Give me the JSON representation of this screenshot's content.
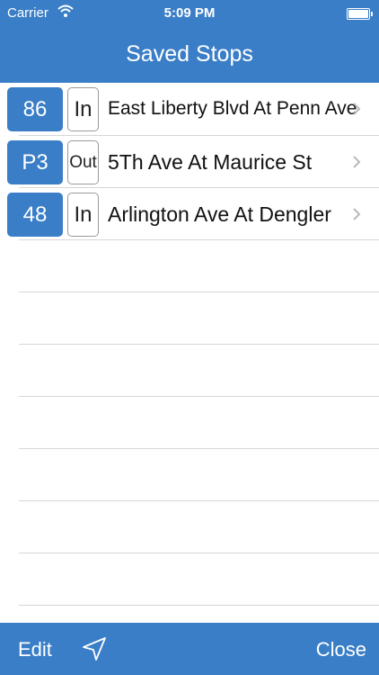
{
  "status_bar": {
    "carrier": "Carrier",
    "time": "5:09 PM",
    "wifi_icon": "wifi-icon",
    "battery_icon": "battery-icon"
  },
  "nav": {
    "title": "Saved Stops"
  },
  "stops": [
    {
      "route": "86",
      "direction": "In",
      "name": "East Liberty Blvd At Penn Ave"
    },
    {
      "route": "P3",
      "direction": "Out",
      "name": "5Th Ave At Maurice St"
    },
    {
      "route": "48",
      "direction": "In",
      "name": "Arlington Ave At Dengler"
    }
  ],
  "toolbar": {
    "edit_label": "Edit",
    "location_icon": "location-arrow-icon",
    "close_label": "Close"
  },
  "colors": {
    "accent": "#3a7ec7",
    "separator": "#d6d6d6",
    "background": "#ffffff"
  }
}
